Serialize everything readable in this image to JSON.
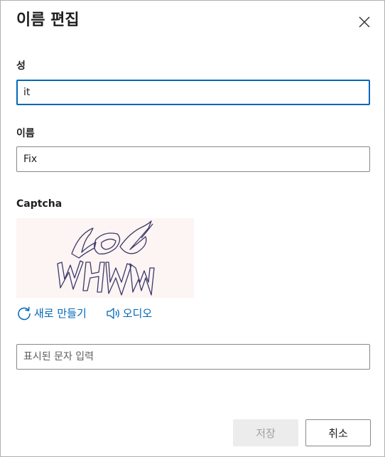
{
  "dialog": {
    "title": "이름 편집"
  },
  "fields": {
    "last_name": {
      "label": "성",
      "value": "it"
    },
    "first_name": {
      "label": "이름",
      "value": "Fix"
    }
  },
  "captcha": {
    "label": "Captcha",
    "refresh_label": "새로 만들기",
    "audio_label": "오디오",
    "input_placeholder": "표시된 문자 입력",
    "input_value": ""
  },
  "buttons": {
    "save_label": "저장",
    "cancel_label": "취소"
  },
  "colors": {
    "accent": "#0067b8",
    "disabled_button_bg": "#ececec",
    "captcha_ink": "#3a3a6a"
  },
  "icons": {
    "close": "close-icon",
    "refresh": "refresh-icon",
    "audio": "speaker-icon"
  }
}
